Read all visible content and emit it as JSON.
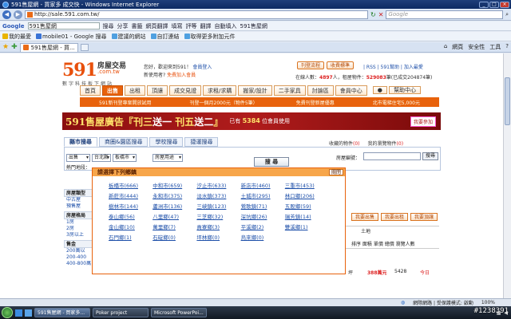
{
  "window": {
    "title": "591售屋網 - 買家多 成交快 - Windows Internet Explorer"
  },
  "address": {
    "url": "http://sale.591.com.tw/",
    "search_placeholder": "Google"
  },
  "google_toolbar": {
    "logo": "Google",
    "search_value": "591售屋網",
    "items": [
      "搜尋",
      "分享",
      "書籤",
      "網頁翻譯",
      "填寫",
      "評等",
      "翻譯",
      "自動填入",
      "591售屋網"
    ]
  },
  "favorites_bar": {
    "items": [
      "我的最愛",
      "mobile01 - Google 搜尋",
      "建議的網站",
      "自訂連結",
      "取得更多附加元件"
    ]
  },
  "tabbar": {
    "tab_label": "591售屋網 - 買...",
    "right_items": [
      "網頁",
      "安全性",
      "工具"
    ]
  },
  "header": {
    "logo_num": "591",
    "logo_zh": "房屋交易",
    "logo_dom": ".com.tw",
    "logo_sub": "數字科技板下網站",
    "welcome": "您好，歡迎來到591！",
    "login": "會員登入",
    "newuser": "新使用者?",
    "register": "免費加入會員",
    "btn_process": "刊登流程",
    "btn_fee": "收費標準",
    "links": "| RSS | 591幫助 | 加入最愛",
    "online_label": "在線人數：",
    "online_count": "4897",
    "online_unit": "人，租屋物件：",
    "listing_count": "529083",
    "listing_note": "筆(已成交204874筆)"
  },
  "mainnav": [
    "首頁",
    "出售",
    "出租",
    "頂讓",
    "成交見證",
    "求租/求購",
    "搬家/設計",
    "二手家具",
    "討論區",
    "會員中心",
    "幫助中心"
  ],
  "subnav": [
    "591新刊登專案開放試用",
    "刊登一個月2000元（物件5筆）",
    "免費刊登新屋優惠",
    "北市電梯住宅5,000元"
  ],
  "banner": {
    "prefix": "591售屋廣告『",
    "p1": "刊三",
    "p2": "送一",
    "p3": "刊五",
    "p4": "送二",
    "suffix": "』",
    "count_label": "已有",
    "count": "5384",
    "count_tail": "位會員使用",
    "cta": "我要參加"
  },
  "search_tabs": [
    "縣市搜尋",
    "商圈&園區搜尋",
    "學校搜尋",
    "捷運搜尋"
  ],
  "right_links": {
    "fav_label": "收藏的物件",
    "fav_count": "(0)",
    "history_label": "我的瀏覽物件",
    "history_count": "(0)"
  },
  "search": {
    "type": "出售",
    "city": "台北縣",
    "district": "板橋市",
    "usage": "房屋用途",
    "button": "搜 尋",
    "keyword_label": "房屋編號：",
    "go": "搜尋",
    "hot_label": "熱門地段："
  },
  "popup": {
    "title": "請選擇下列鄉鎮",
    "close": "關閉",
    "towns": [
      "板橋市(666)",
      "中和市(659)",
      "汐止市(633)",
      "新店市(460)",
      "三重市(453)",
      "新莊市(444)",
      "永和市(375)",
      "淡水鎮(373)",
      "土城市(295)",
      "林口鄉(206)",
      "樹林市(144)",
      "蘆洲市(136)",
      "三峽鎮(123)",
      "鶯歌鎮(71)",
      "五股鄉(59)",
      "泰山鄉(56)",
      "八里鄉(47)",
      "三芝鄉(32)",
      "深坑鄉(26)",
      "瑞芳鎮(14)",
      "金山鄉(10)",
      "萬里鄉(7)",
      "貢寮鄉(3)",
      "平溪鄉(2)",
      "雙溪鄉(1)",
      "石門鄉(1)",
      "石碇鄉(0)",
      "坪林鄉(0)",
      "烏來鄉(0)"
    ]
  },
  "side": {
    "h1": "房屋類型",
    "h1_items": [
      "中古屋",
      "預售屋"
    ],
    "h2": "房屋格局",
    "h2_items": [
      "1房",
      "2房",
      "3房以上"
    ],
    "h3": "售金",
    "h3_items": [
      "200萬以",
      "200-400",
      "400-800萬"
    ]
  },
  "right_buttons": [
    "我要出售",
    "我要出租",
    "我要頂讓"
  ],
  "listing": {
    "col": "土地",
    "sort_labels": "排序 面積 單價 總價 瀏覽人數",
    "price": "388萬元",
    "views": "5428",
    "today": "今日",
    "tail": "坪"
  },
  "status": {
    "zone": "網際網路 | 受保護模式: 啟動",
    "zoom": "100%"
  },
  "taskbar": {
    "tasks": [
      "591售屋網 - 買家多...",
      "Poker project",
      "Microsoft PowerPoi..."
    ],
    "watermark": "#1238391"
  },
  "colors": {
    "accent": "#e8620c",
    "link": "#1d4fa9",
    "banner": "#b01c1c"
  }
}
